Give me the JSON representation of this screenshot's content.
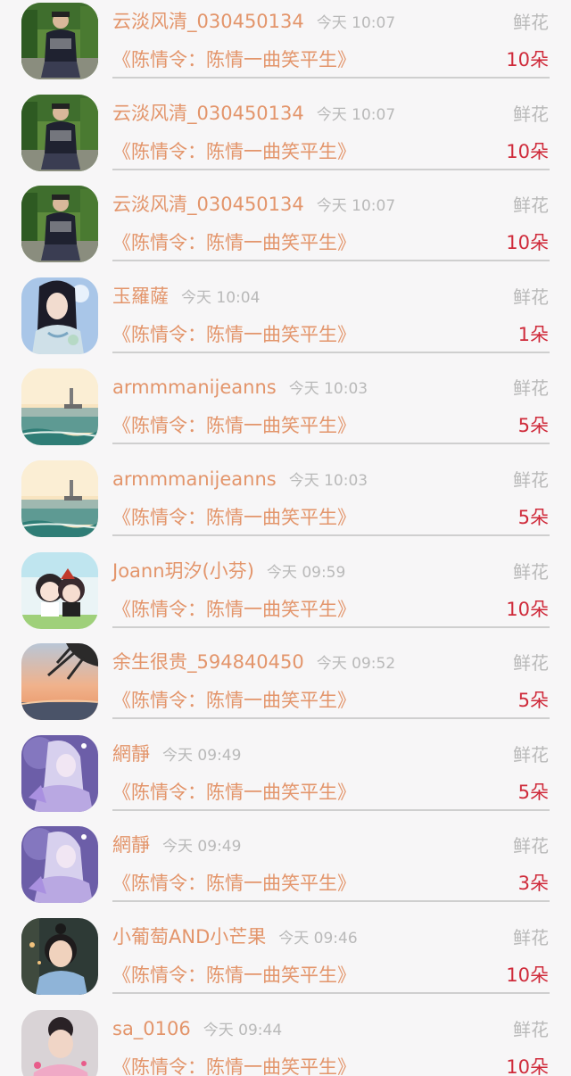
{
  "gift_list": {
    "items": [
      {
        "name": "云淡风清_030450134",
        "time": "今天 10:07",
        "type": "鲜花",
        "book": "《陈情令：陈情一曲笑平生》",
        "amount": "10朵",
        "avatar": "man-in-park"
      },
      {
        "name": "云淡风清_030450134",
        "time": "今天 10:07",
        "type": "鲜花",
        "book": "《陈情令：陈情一曲笑平生》",
        "amount": "10朵",
        "avatar": "man-in-park"
      },
      {
        "name": "云淡风清_030450134",
        "time": "今天 10:07",
        "type": "鲜花",
        "book": "《陈情令：陈情一曲笑平生》",
        "amount": "10朵",
        "avatar": "man-in-park"
      },
      {
        "name": "玉羅薩",
        "time": "今天 10:04",
        "type": "鲜花",
        "book": "《陈情令：陈情一曲笑平生》",
        "amount": "1朵",
        "avatar": "costume-girl"
      },
      {
        "name": "armmmanijeanns",
        "time": "今天 10:03",
        "type": "鲜花",
        "book": "《陈情令：陈情一曲笑平生》",
        "amount": "5朵",
        "avatar": "sea-lighthouse"
      },
      {
        "name": "armmmanijeanns",
        "time": "今天 10:03",
        "type": "鲜花",
        "book": "《陈情令：陈情一曲笑平生》",
        "amount": "5朵",
        "avatar": "sea-lighthouse"
      },
      {
        "name": "Joann玥汐(小芬)",
        "time": "今天 09:59",
        "type": "鲜花",
        "book": "《陈情令：陈情一曲笑平生》",
        "amount": "10朵",
        "avatar": "chibi-pair"
      },
      {
        "name": "余生很贵_594840450",
        "time": "今天 09:52",
        "type": "鲜花",
        "book": "《陈情令：陈情一曲笑平生》",
        "amount": "5朵",
        "avatar": "sunset-tree"
      },
      {
        "name": "網靜",
        "time": "今天 09:49",
        "type": "鲜花",
        "book": "《陈情令：陈情一曲笑平生》",
        "amount": "5朵",
        "avatar": "purple-fairy"
      },
      {
        "name": "網靜",
        "time": "今天 09:49",
        "type": "鲜花",
        "book": "《陈情令：陈情一曲笑平生》",
        "amount": "3朵",
        "avatar": "purple-fairy"
      },
      {
        "name": "小葡萄AND小芒果",
        "time": "今天 09:46",
        "type": "鲜花",
        "book": "《陈情令：陈情一曲笑平生》",
        "amount": "10朵",
        "avatar": "little-girl"
      },
      {
        "name": "sa_0106",
        "time": "今天 09:44",
        "type": "鲜花",
        "book": "《陈情令：陈情一曲笑平生》",
        "amount": "10朵",
        "avatar": "child-pink"
      }
    ]
  }
}
